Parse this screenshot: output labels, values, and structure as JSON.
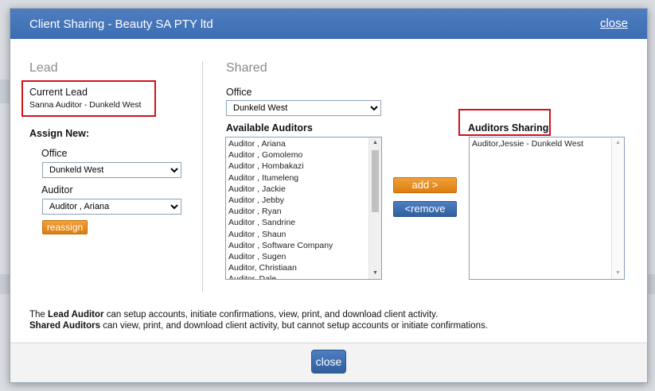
{
  "dialog": {
    "title": "Client Sharing - Beauty SA PTY ltd",
    "close_link": "close",
    "close_button": "close"
  },
  "lead": {
    "heading": "Lead",
    "current_lead_label": "Current Lead",
    "current_lead_value": "Sanna Auditor - Dunkeld West",
    "assign_new_label": "Assign New:",
    "office_label": "Office",
    "office_value": "Dunkeld West",
    "auditor_label": "Auditor",
    "auditor_value": "Auditor , Ariana",
    "reassign_button": "reassign"
  },
  "shared": {
    "heading": "Shared",
    "office_label": "Office",
    "office_value": "Dunkeld West",
    "available_label": "Available Auditors",
    "available_auditors": [
      "Auditor , Ariana",
      "Auditor , Gomolemo",
      "Auditor , Hombakazi",
      "Auditor , Itumeleng",
      "Auditor , Jackie",
      "Auditor , Jebby",
      "Auditor , Ryan",
      "Auditor , Sandrine",
      "Auditor , Shaun",
      "Auditor , Software Company",
      "Auditor , Sugen",
      "Auditor, Christiaan",
      "Auditor, Dale"
    ],
    "add_button": "add >",
    "remove_button": "<remove",
    "sharing_label": "Auditors Sharing",
    "sharing_auditors": [
      "Auditor,Jessie - Dunkeld West"
    ]
  },
  "footer": {
    "line1_bold": "Lead Auditor",
    "line1_prefix": "The ",
    "line1_rest": " can setup accounts, initiate confirmations, view, print, and download client activity.",
    "line2_bold": "Shared Auditors",
    "line2_rest": " can view, print, and download client activity, but cannot setup accounts or initiate confirmations."
  },
  "colors": {
    "titlebar": "#3c6db3",
    "accent_orange": "#dd7d0f",
    "highlight_red": "#d0121b"
  }
}
